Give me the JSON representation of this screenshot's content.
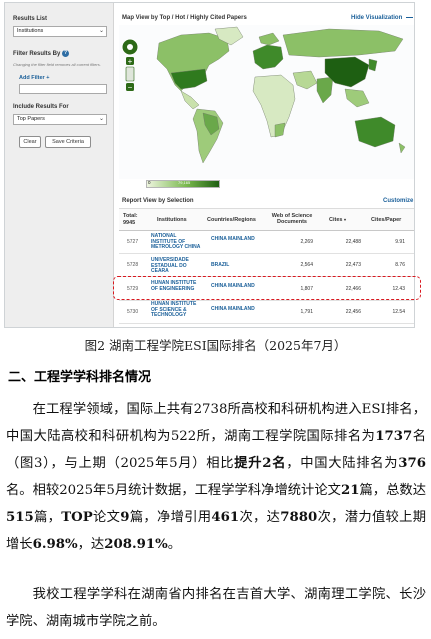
{
  "sidebar": {
    "results_list_label": "Results List",
    "results_list_value": "Institutions",
    "filter_label": "Filter Results By",
    "filter_note": "Changing the filter field removes all current filters.",
    "add_filter": "Add Filter +",
    "include_label": "Include Results For",
    "include_value": "Top Papers",
    "clear_button": "Clear",
    "save_button": "Save Criteria"
  },
  "map": {
    "title": "Map View by Top / Hot / Highly Cited Papers",
    "hide_link": "Hide Visualization",
    "legend_min": "0",
    "legend_max": "79,165"
  },
  "report": {
    "title": "Report View by Selection",
    "customize": "Customize",
    "headers": {
      "total": "Total:",
      "total_count": "9945",
      "institutions": "Institutions",
      "countries": "Countries/Regions",
      "wos": "Web of Science Documents",
      "cites": "Cites",
      "cites_per_paper": "Cites/Paper"
    },
    "rows": [
      {
        "rank": "5727",
        "institution": "NATIONAL INSTITUTE OF METROLOGY CHINA",
        "country": "CHINA MAINLAND",
        "wos": "2,269",
        "cites": "22,488",
        "cpp": "9.91"
      },
      {
        "rank": "5728",
        "institution": "UNIVERSIDADE ESTADUAL DO CEARA",
        "country": "BRAZIL",
        "wos": "2,564",
        "cites": "22,473",
        "cpp": "8.76"
      },
      {
        "rank": "5729",
        "institution": "HUNAN INSTITUTE OF ENGINEERING",
        "country": "CHINA MAINLAND",
        "wos": "1,807",
        "cites": "22,466",
        "cpp": "12.43"
      },
      {
        "rank": "5730",
        "institution": "HUNAN INSTITUTE OF SCIENCE & TECHNOLOGY",
        "country": "CHINA MAINLAND",
        "wos": "1,791",
        "cites": "22,456",
        "cpp": "12.54"
      }
    ]
  },
  "caption": "图2  湖南工程学院ESI国际排名（2025年7月）",
  "section_title": "二、工程学学科排名情况",
  "paragraph1": {
    "t1": "在工程学领域，国际上共有2738所高校和科研机构进入ESI排名，中国大陆高校和科研机构为522所，湖南工程学院国际排名为",
    "b1": "1737",
    "t2": "名（图3），与上期（2025年5月）相比",
    "b2": "提升2名",
    "t3": "，中国大陆排名为",
    "b3": "376",
    "t4": "名。相较2025年5月统计数据，工程学学科净增统计论文",
    "b4": "21",
    "t5": "篇，总数达",
    "b5": "515",
    "t6": "篇，",
    "b6": "TOP",
    "t7": "论文",
    "b7": "9",
    "t8": "篇，净增引用",
    "b8": "461",
    "t9": "次，达",
    "b9": "7880",
    "t10": "次，潜力值较上期增长",
    "b10": "6.98%",
    "t11": "，达",
    "b11": "208.91%",
    "t12": "。"
  },
  "paragraph2": "我校工程学学科在湖南省内排名在吉首大学、湖南理工学院、长沙学院、湖南城市学院之前。",
  "colors": {
    "link": "#1a5f99",
    "highlight": "#d9181f",
    "map_dark": "#1e5f12",
    "map_light": "#eef5df"
  }
}
